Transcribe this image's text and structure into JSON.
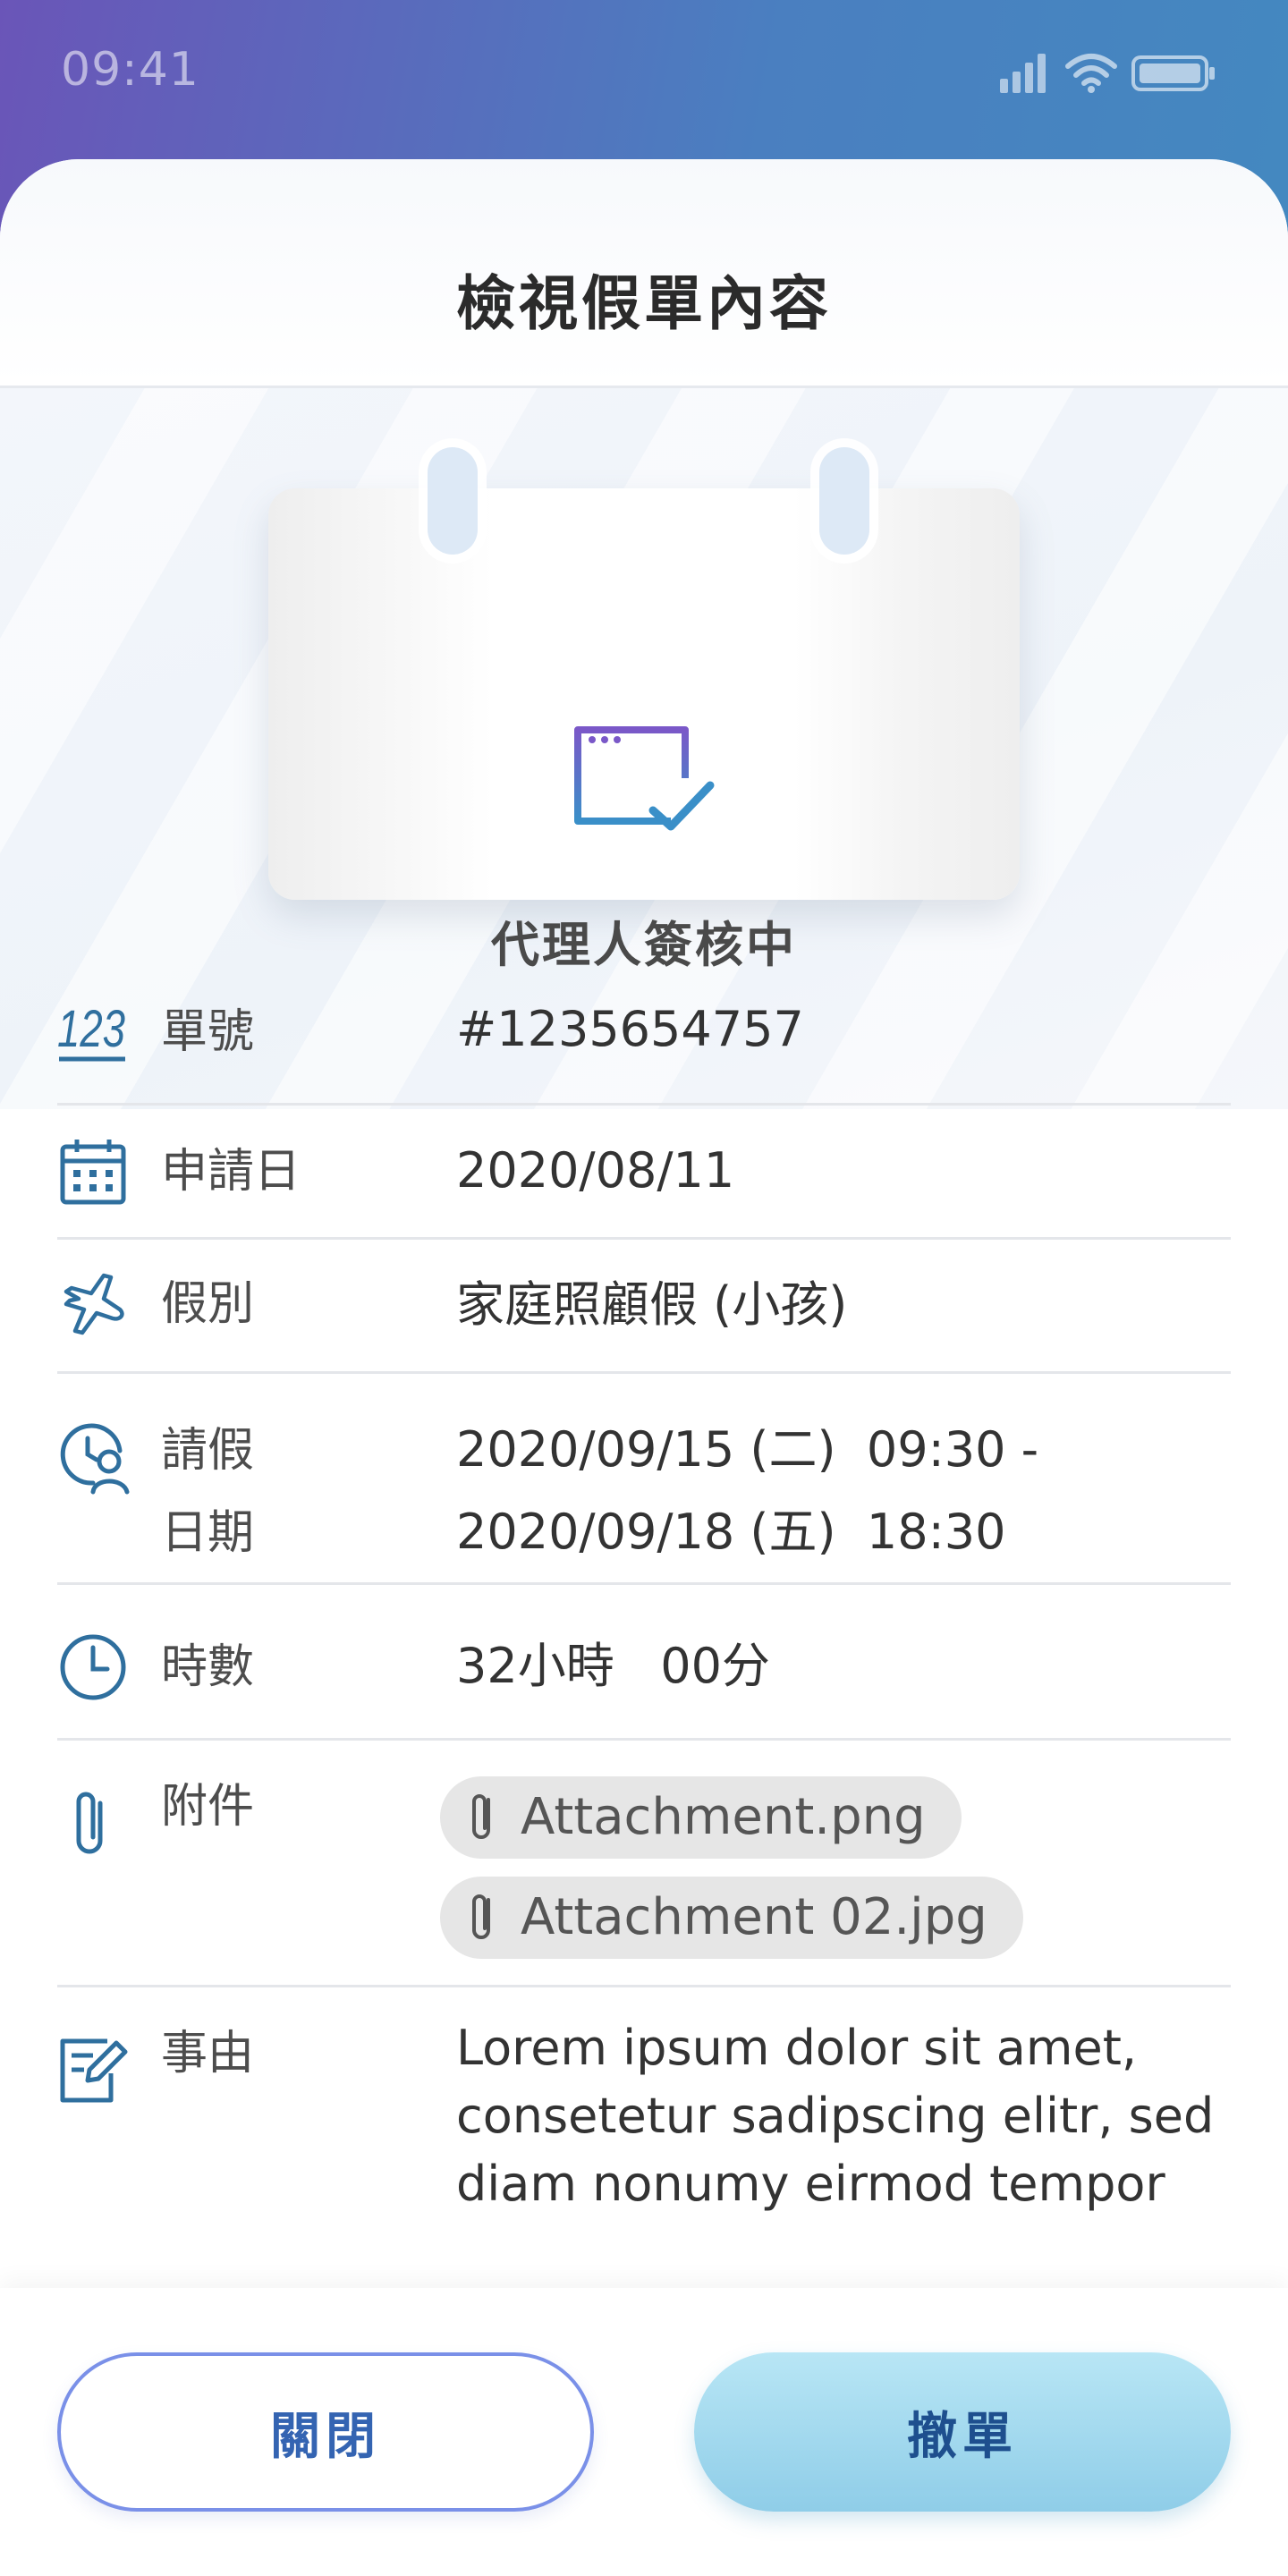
{
  "status_bar": {
    "time": "09:41",
    "icons": [
      "signal-icon",
      "wifi-icon",
      "battery-icon"
    ]
  },
  "header": {
    "title": "檢視假單內容"
  },
  "hero": {
    "icon": "document-check-icon",
    "status": "代理人簽核中"
  },
  "fields": {
    "number": {
      "label": "單號",
      "value": "#1235654757",
      "icon": "number-123-icon"
    },
    "apply_date": {
      "label": "申請日",
      "value": "2020/08/11",
      "icon": "calendar-icon"
    },
    "leave_type": {
      "label": "假別",
      "value": "家庭照顧假 (小孩)",
      "icon": "airplane-icon"
    },
    "leave_period": {
      "label_line1": "請假",
      "label_line2": "日期",
      "start": "2020/09/15 (二)  09:30 -",
      "end": "2020/09/18 (五)  18:30",
      "icon": "clock-user-icon"
    },
    "hours": {
      "label": "時數",
      "value": "32小時   00分",
      "icon": "clock-icon"
    },
    "attachments": {
      "label": "附件",
      "icon": "paperclip-icon",
      "files": [
        "Attachment.png",
        "Attachment 02.jpg"
      ]
    },
    "reason": {
      "label": "事由",
      "icon": "edit-note-icon",
      "value": "Lorem ipsum dolor sit amet, consetetur sadipscing elitr, sed diam nonumy eirmod tempor"
    }
  },
  "footer": {
    "close_label": "關閉",
    "withdraw_label": "撤單"
  },
  "colors": {
    "icon_blue": "#2f6f9e",
    "accent_purple": "#7a58c8",
    "button_outline": "#7a90e8",
    "button_fill": "#9fd6ec"
  }
}
